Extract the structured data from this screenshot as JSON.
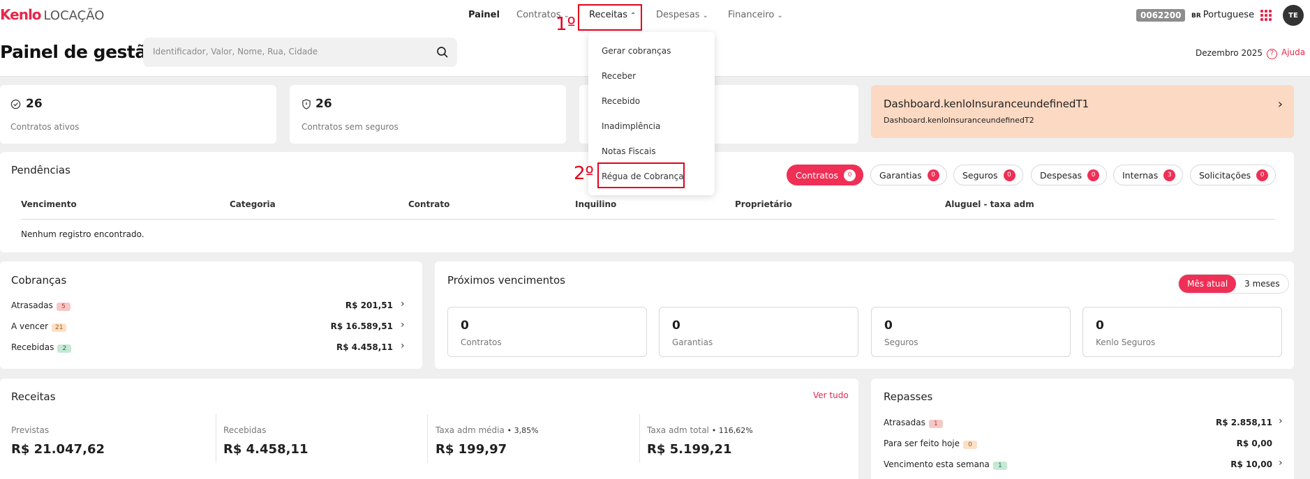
{
  "brand": {
    "name": "Kenlo",
    "product": "LOCAÇÃO"
  },
  "nav": {
    "painel": "Painel",
    "contratos": "Contratos",
    "receitas": "Receitas",
    "despesas": "Despesas",
    "financeiro": "Financeiro"
  },
  "account_code": "0062200",
  "language": {
    "flag": "BR",
    "label": "Portuguese"
  },
  "avatar_initials": "TE",
  "page_title": "Painel de gestão",
  "search": {
    "placeholder": "Identificador, Valor, Nome, Rua, Cidade"
  },
  "month": "Dezembro 2025",
  "help": "Ajuda",
  "stats": [
    {
      "value": "26",
      "label": "Contratos ativos",
      "icon": "check-circle-icon"
    },
    {
      "value": "26",
      "label": "Contratos sem seguros",
      "icon": "shield-icon"
    }
  ],
  "promo": {
    "title": "Dashboard.kenloInsuranceundefinedT1",
    "subtitle": "Dashboard.kenloInsuranceundefinedT2"
  },
  "receitas_menu": [
    "Gerar cobranças",
    "Receber",
    "Recebido",
    "Inadimplência",
    "Notas Fiscais",
    "Régua de Cobrança"
  ],
  "annotations": {
    "step1": "1º",
    "step2": "2º"
  },
  "pendencias": {
    "title": "Pendências",
    "filters": [
      {
        "label": "Contratos",
        "count": "0"
      },
      {
        "label": "Garantias",
        "count": "0"
      },
      {
        "label": "Seguros",
        "count": "0"
      },
      {
        "label": "Despesas",
        "count": "0"
      },
      {
        "label": "Internas",
        "count": "3"
      },
      {
        "label": "Solicitações",
        "count": "0"
      }
    ],
    "columns": [
      "Vencimento",
      "Categoria",
      "Contrato",
      "Inquilino",
      "Proprietário",
      "Aluguel - taxa adm"
    ],
    "empty": "Nenhum registro encontrado."
  },
  "cobrancas": {
    "title": "Cobranças",
    "rows": [
      {
        "label": "Atrasadas",
        "count": "5",
        "value": "R$ 201,51"
      },
      {
        "label": "A vencer",
        "count": "21",
        "value": "R$ 16.589,51"
      },
      {
        "label": "Recebidas",
        "count": "2",
        "value": "R$ 4.458,11"
      }
    ]
  },
  "proximos": {
    "title": "Próximos vencimentos",
    "toggle": [
      "Mês atual",
      "3 meses"
    ],
    "boxes": [
      {
        "value": "0",
        "label": "Contratos"
      },
      {
        "value": "0",
        "label": "Garantias"
      },
      {
        "value": "0",
        "label": "Seguros"
      },
      {
        "value": "0",
        "label": "Kenlo Seguros"
      }
    ]
  },
  "receitas": {
    "title": "Receitas",
    "link": "Ver tudo",
    "cols": [
      {
        "label": "Previstas",
        "extra": "",
        "value": "R$ 21.047,62"
      },
      {
        "label": "Recebidas",
        "extra": "",
        "value": "R$ 4.458,11"
      },
      {
        "label": "Taxa adm média",
        "extra": "• 3,85%",
        "value": "R$ 199,97"
      },
      {
        "label": "Taxa adm total",
        "extra": "• 116,62%",
        "value": "R$ 5.199,21"
      }
    ]
  },
  "repasses": {
    "title": "Repasses",
    "rows": [
      {
        "label": "Atrasadas",
        "count": "1",
        "value": "R$ 2.858,11"
      },
      {
        "label": "Para ser feito hoje",
        "count": "0",
        "value": "R$ 0,00"
      },
      {
        "label": "Vencimento esta semana",
        "count": "1",
        "value": "R$ 10,00"
      }
    ]
  }
}
